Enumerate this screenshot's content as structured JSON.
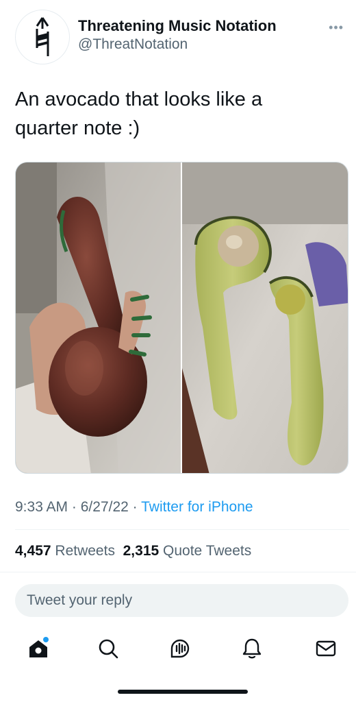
{
  "tweet": {
    "display_name": "Threatening Music Notation",
    "handle": "@ThreatNotation",
    "more_icon": "ellipsis-icon",
    "text": "An avocado that looks like a\nquarter note :)",
    "time": "9:33 AM",
    "date": "6/27/22",
    "source": "Twitter for iPhone",
    "retweets_count": "4,457",
    "retweets_label": "Retweets",
    "quote_tweets_count": "2,315",
    "quote_tweets_label": "Quote Tweets",
    "meta_separator": "·"
  },
  "reply": {
    "placeholder": "Tweet your reply"
  },
  "nav": {
    "items": [
      {
        "icon": "home-icon",
        "has_notification_dot": true
      },
      {
        "icon": "search-icon"
      },
      {
        "icon": "spaces-icon"
      },
      {
        "icon": "notifications-icon"
      },
      {
        "icon": "messages-icon"
      }
    ]
  },
  "colors": {
    "accent": "#1d9bf0",
    "text_primary": "#0f1419",
    "text_secondary": "#536471",
    "reply_bg": "#eff3f4"
  }
}
